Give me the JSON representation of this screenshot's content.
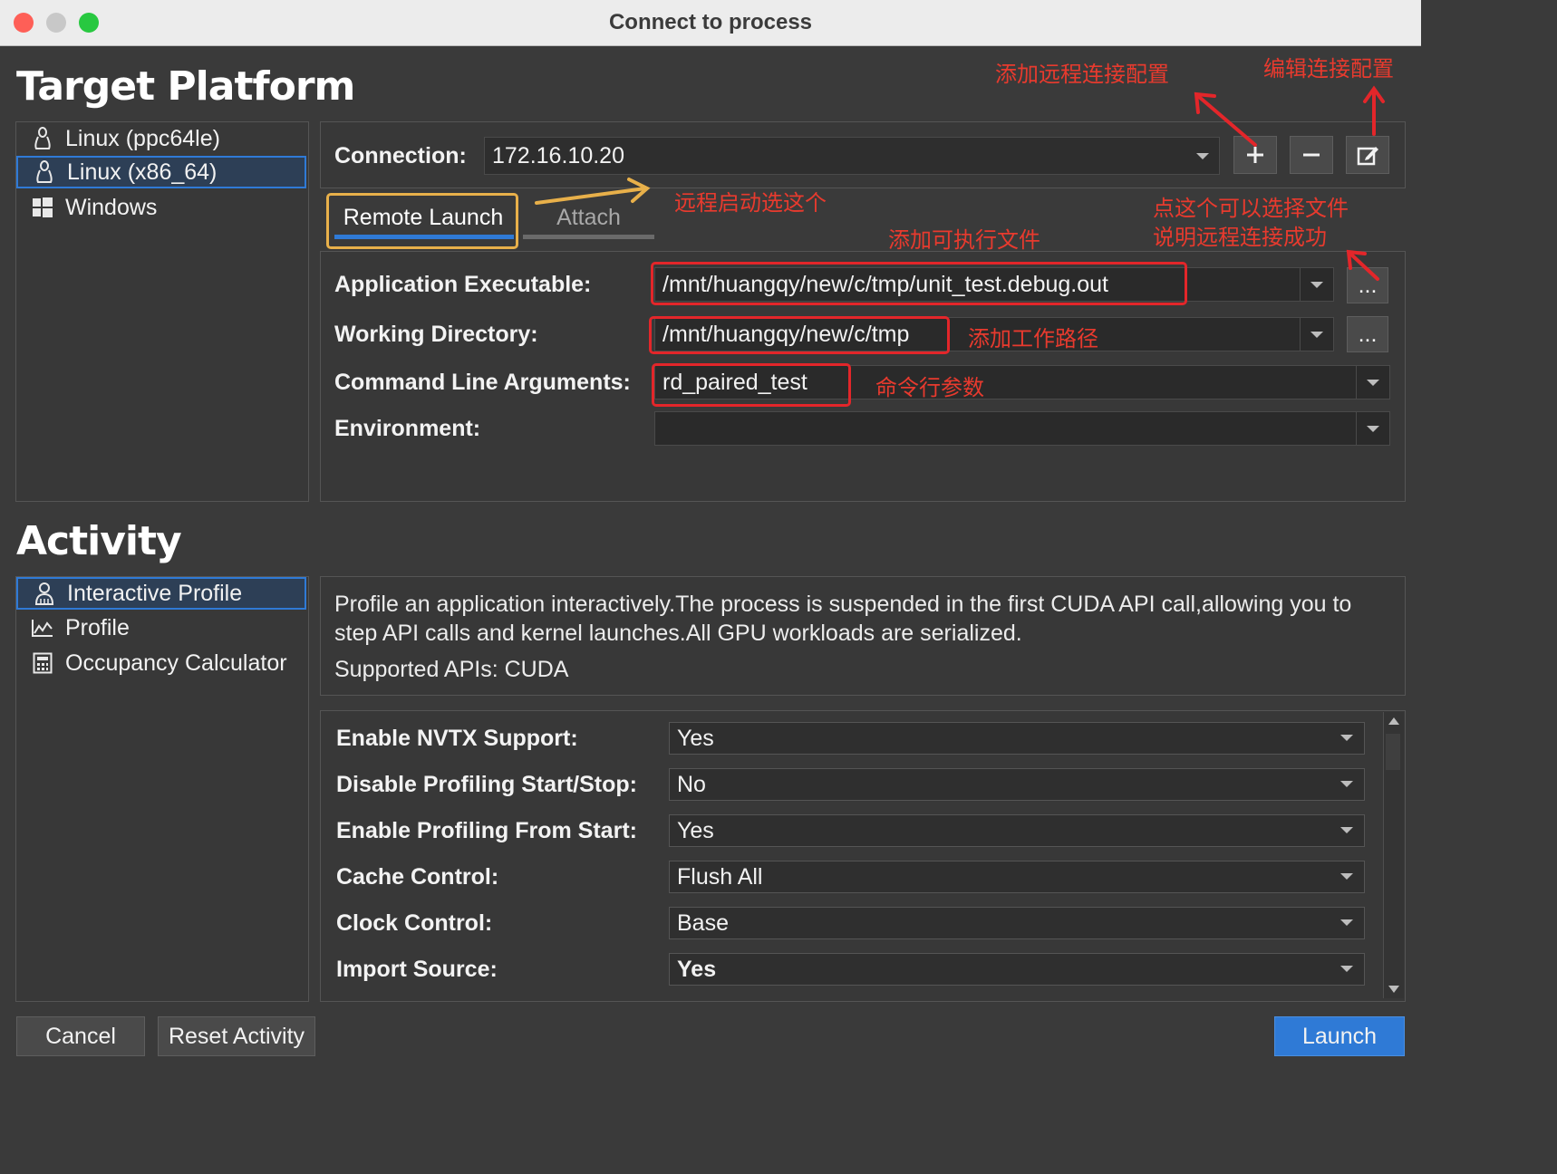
{
  "window": {
    "title": "Connect to process"
  },
  "target_platform": {
    "heading": "Target Platform",
    "platforms": [
      {
        "label": "Linux (ppc64le)",
        "icon": "linux-icon"
      },
      {
        "label": "Linux (x86_64)",
        "icon": "linux-icon",
        "selected": true
      },
      {
        "label": "Windows",
        "icon": "windows-icon"
      }
    ],
    "connection_label": "Connection:",
    "connection_value": "172.16.10.20",
    "tabs": [
      {
        "label": "Remote Launch",
        "active": true
      },
      {
        "label": "Attach"
      }
    ],
    "fields": {
      "app_exec_label": "Application Executable:",
      "app_exec_value": "/mnt/huangqy/new/c/tmp/unit_test.debug.out",
      "workdir_label": "Working Directory:",
      "workdir_value": "/mnt/huangqy/new/c/tmp",
      "args_label": "Command Line Arguments:",
      "args_value": "rd_paired_test",
      "env_label": "Environment:",
      "env_value": "",
      "browse_label": "..."
    }
  },
  "activity": {
    "heading": "Activity",
    "items": [
      {
        "label": "Interactive Profile",
        "icon": "person-icon",
        "selected": true
      },
      {
        "label": "Profile",
        "icon": "chart-icon"
      },
      {
        "label": "Occupancy Calculator",
        "icon": "calculator-icon"
      }
    ],
    "description": "Profile an application interactively.The process is suspended in the first CUDA API call,allowing you to step API calls and kernel launches.All GPU workloads are serialized.",
    "supported": "Supported APIs: CUDA",
    "options": [
      {
        "label": "Enable NVTX Support:",
        "value": "Yes"
      },
      {
        "label": "Disable Profiling Start/Stop:",
        "value": "No"
      },
      {
        "label": "Enable Profiling From Start:",
        "value": "Yes"
      },
      {
        "label": "Cache Control:",
        "value": "Flush All"
      },
      {
        "label": "Clock Control:",
        "value": "Base"
      },
      {
        "label": "Import Source:",
        "value": "Yes"
      }
    ]
  },
  "buttons": {
    "cancel": "Cancel",
    "reset": "Reset Activity",
    "launch": "Launch"
  },
  "annotations": {
    "add_remote": "添加远程连接配置",
    "edit_conn": "编辑连接配置",
    "choose_this": "远程启动选这个",
    "add_exec": "添加可执行文件",
    "browse_note_1": "点这个可以选择文件",
    "browse_note_2": "说明远程连接成功",
    "add_workdir": "添加工作路径",
    "cmd_args": "命令行参数"
  },
  "colors": {
    "accent": "#2f7ad6",
    "annotation": "#e3262a",
    "highlight": "#e8b04a",
    "launch": "#2f7ad6"
  }
}
